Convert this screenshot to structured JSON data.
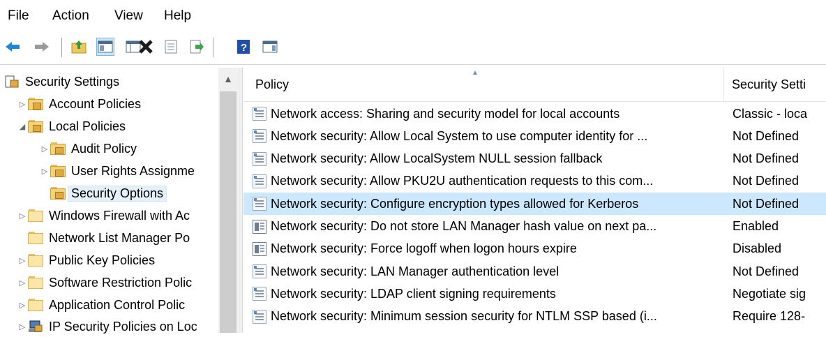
{
  "menu": [
    "File",
    "Action",
    "View",
    "Help"
  ],
  "toolbar_icons": [
    "back-arrow-icon",
    "forward-arrow-icon",
    "up-folder-icon",
    "show-hide-console-tree-icon",
    "delete-icon",
    "properties-icon",
    "export-list-icon",
    "help-icon",
    "show-hide-action-pane-icon"
  ],
  "tree": {
    "root": "Security Settings",
    "items": [
      {
        "label": "Account Policies",
        "expander": "▷"
      },
      {
        "label": "Local Policies",
        "expander": "◢"
      },
      {
        "label": "Audit Policy",
        "expander": "▷"
      },
      {
        "label": "User Rights Assignme",
        "expander": "▷"
      },
      {
        "label": "Security Options",
        "expander": ""
      },
      {
        "label": "Windows Firewall with Ac",
        "expander": "▷"
      },
      {
        "label": "Network List Manager Po",
        "expander": ""
      },
      {
        "label": "Public Key Policies",
        "expander": "▷"
      },
      {
        "label": "Software Restriction Polic",
        "expander": "▷"
      },
      {
        "label": "Application Control Polic",
        "expander": "▷"
      },
      {
        "label": "IP Security Policies on Loc",
        "expander": "▷"
      }
    ]
  },
  "list": {
    "columns": [
      "Policy",
      "Security Setti"
    ],
    "rows": [
      {
        "policy": "Network access: Sharing and security model for local accounts",
        "setting": "Classic - loca",
        "icon": "text-policy-icon"
      },
      {
        "policy": "Network security: Allow Local System to use computer identity for ...",
        "setting": "Not Defined",
        "icon": "text-policy-icon"
      },
      {
        "policy": "Network security: Allow LocalSystem NULL session fallback",
        "setting": "Not Defined",
        "icon": "text-policy-icon"
      },
      {
        "policy": "Network security: Allow PKU2U authentication requests to this com...",
        "setting": "Not Defined",
        "icon": "text-policy-icon"
      },
      {
        "policy": "Network security: Configure encryption types allowed for Kerberos",
        "setting": "Not Defined",
        "icon": "text-policy-icon",
        "selected": true
      },
      {
        "policy": "Network security: Do not store LAN Manager hash value on next pa...",
        "setting": "Enabled",
        "icon": "binary-policy-icon"
      },
      {
        "policy": "Network security: Force logoff when logon hours expire",
        "setting": "Disabled",
        "icon": "binary-policy-icon"
      },
      {
        "policy": "Network security: LAN Manager authentication level",
        "setting": "Not Defined",
        "icon": "text-policy-icon"
      },
      {
        "policy": "Network security: LDAP client signing requirements",
        "setting": "Negotiate sig",
        "icon": "text-policy-icon"
      },
      {
        "policy": "Network security: Minimum session security for NTLM SSP based (i...",
        "setting": "Require 128-",
        "icon": "text-policy-icon"
      }
    ]
  },
  "colors": {
    "selection": "#cce8ff",
    "tree_selection": "#e5f0fb"
  }
}
